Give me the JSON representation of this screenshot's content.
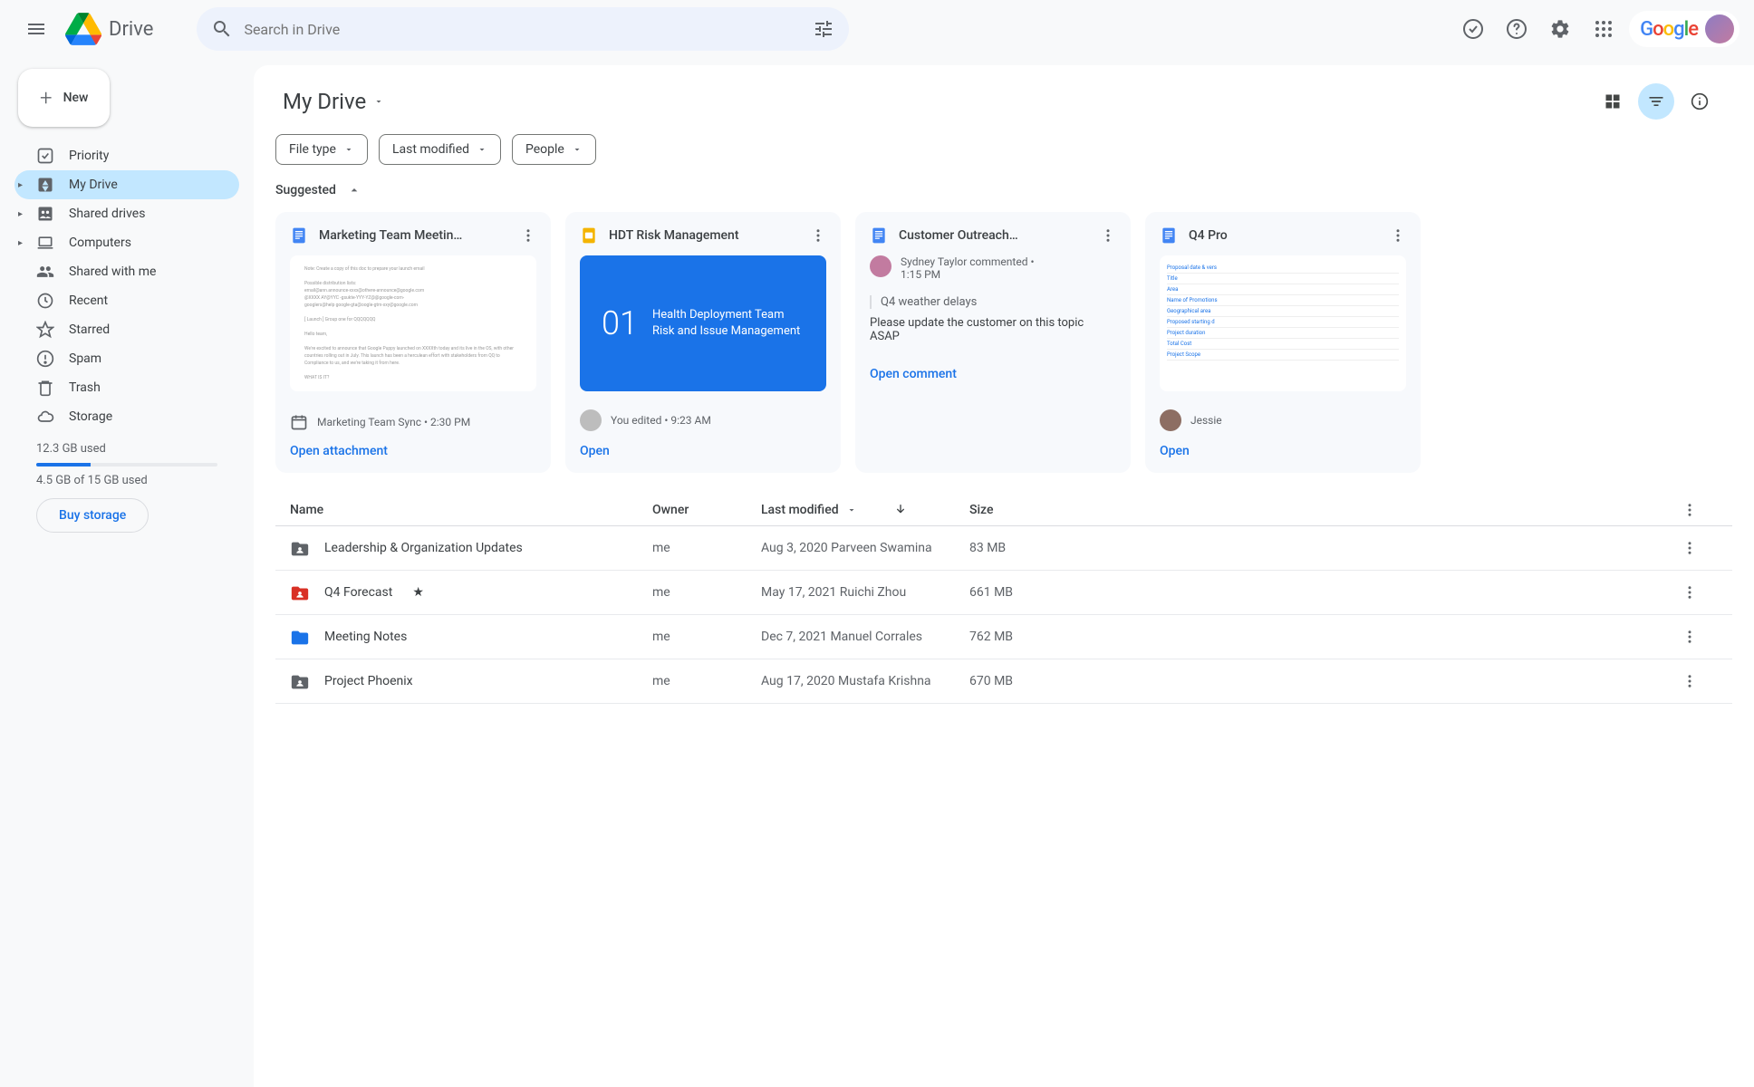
{
  "app": {
    "name": "Drive"
  },
  "search": {
    "placeholder": "Search in Drive"
  },
  "new_button": "New",
  "sidebar": {
    "items": [
      {
        "label": "Priority",
        "icon": "check-square"
      },
      {
        "label": "My Drive",
        "icon": "drive",
        "expandable": true,
        "active": true
      },
      {
        "label": "Shared drives",
        "icon": "shared-drive",
        "expandable": true
      },
      {
        "label": "Computers",
        "icon": "laptop",
        "expandable": true
      },
      {
        "label": "Shared with me",
        "icon": "people"
      },
      {
        "label": "Recent",
        "icon": "clock"
      },
      {
        "label": "Starred",
        "icon": "star"
      },
      {
        "label": "Spam",
        "icon": "spam"
      },
      {
        "label": "Trash",
        "icon": "trash"
      },
      {
        "label": "Storage",
        "icon": "cloud"
      }
    ],
    "storage_used": "12.3 GB used",
    "storage_detail": "4.5 GB of 15 GB used",
    "buy_storage": "Buy storage"
  },
  "main": {
    "location": "My Drive",
    "filters": [
      "File type",
      "Last modified",
      "People"
    ],
    "suggested_label": "Suggested",
    "suggested": [
      {
        "title": "Marketing Team Meetin…",
        "type": "doc",
        "footer": "Marketing Team Sync • 2:30 PM",
        "action": "Open attachment"
      },
      {
        "title": "HDT Risk Management",
        "type": "slides",
        "slide_num": "01",
        "slide_text": "Health Deployment Team Risk and Issue Management",
        "footer": "You edited • 9:23 AM",
        "action": "Open"
      },
      {
        "title": "Customer Outreach…",
        "type": "doc",
        "comment_author": "Sydney Taylor commented •",
        "comment_time": "1:15 PM",
        "comment_quote": "Q4 weather delays",
        "comment_body": "Please update the customer on this topic ASAP",
        "action": "Open comment"
      },
      {
        "title": "Q4 Pro",
        "type": "doc",
        "footer_person": "Jessie",
        "action": "Open"
      }
    ],
    "columns": {
      "name": "Name",
      "owner": "Owner",
      "modified": "Last modified",
      "size": "Size"
    },
    "rows": [
      {
        "name": "Leadership & Organization Updates",
        "icon": "folder-dark",
        "owner": "me",
        "modified": "Aug 3, 2020 Parveen Swamina",
        "size": "83 MB"
      },
      {
        "name": "Q4 Forecast",
        "icon": "folder-red",
        "starred": true,
        "owner": "me",
        "modified": "May 17, 2021 Ruichi Zhou",
        "size": "661 MB"
      },
      {
        "name": "Meeting Notes",
        "icon": "folder-blue",
        "owner": "me",
        "modified": "Dec 7, 2021 Manuel Corrales",
        "size": "762 MB"
      },
      {
        "name": "Project Phoenix",
        "icon": "folder-dark",
        "owner": "me",
        "modified": "Aug 17, 2020 Mustafa Krishna",
        "size": "670 MB"
      }
    ]
  }
}
